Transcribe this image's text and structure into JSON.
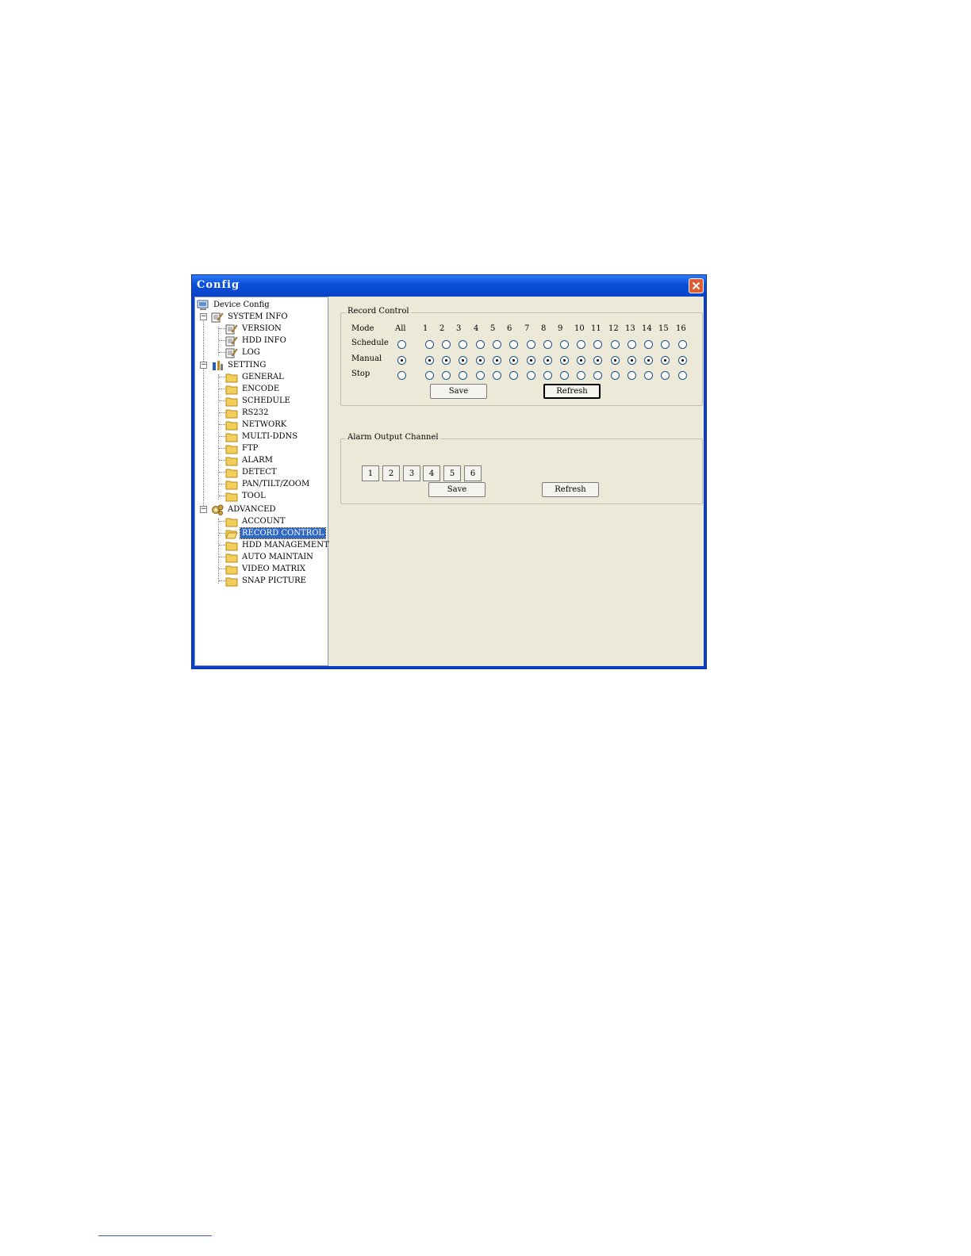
{
  "window": {
    "title": "Config"
  },
  "tree": {
    "root": "Device Config",
    "system_info": {
      "label": "SYSTEM INFO",
      "items": [
        "VERSION",
        "HDD INFO",
        "LOG"
      ]
    },
    "setting": {
      "label": "SETTING",
      "items": [
        "GENERAL",
        "ENCODE",
        "SCHEDULE",
        "RS232",
        "NETWORK",
        "MULTI-DDNS",
        "FTP",
        "ALARM",
        "DETECT",
        "PAN/TILT/ZOOM",
        "TOOL"
      ]
    },
    "advanced": {
      "label": "ADVANCED",
      "items": [
        "ACCOUNT",
        "RECORD CONTROL",
        "HDD MANAGEMENT",
        "AUTO MAINTAIN",
        "VIDEO MATRIX",
        "SNAP PICTURE"
      ]
    },
    "selected": "RECORD CONTROL"
  },
  "record_control": {
    "title": "Record Control",
    "mode_label": "Mode",
    "columns": [
      "All",
      "1",
      "2",
      "3",
      "4",
      "5",
      "6",
      "7",
      "8",
      "9",
      "10",
      "11",
      "12",
      "13",
      "14",
      "15",
      "16"
    ],
    "rows": [
      {
        "label": "Schedule",
        "selected": false
      },
      {
        "label": "Manual",
        "selected": true
      },
      {
        "label": "Stop",
        "selected": false
      }
    ],
    "save_label": "Save",
    "refresh_label": "Refresh"
  },
  "alarm_output": {
    "title": "Alarm Output Channel",
    "channels": [
      "1",
      "2",
      "3",
      "4",
      "5",
      "6"
    ],
    "save_label": "Save",
    "refresh_label": "Refresh"
  },
  "icons": {
    "root": "computer-icon",
    "system_info": "notepad-icon",
    "setting": "tools-icon",
    "advanced": "gears-icon",
    "leaf": "folder-icon",
    "close": "close-icon"
  }
}
